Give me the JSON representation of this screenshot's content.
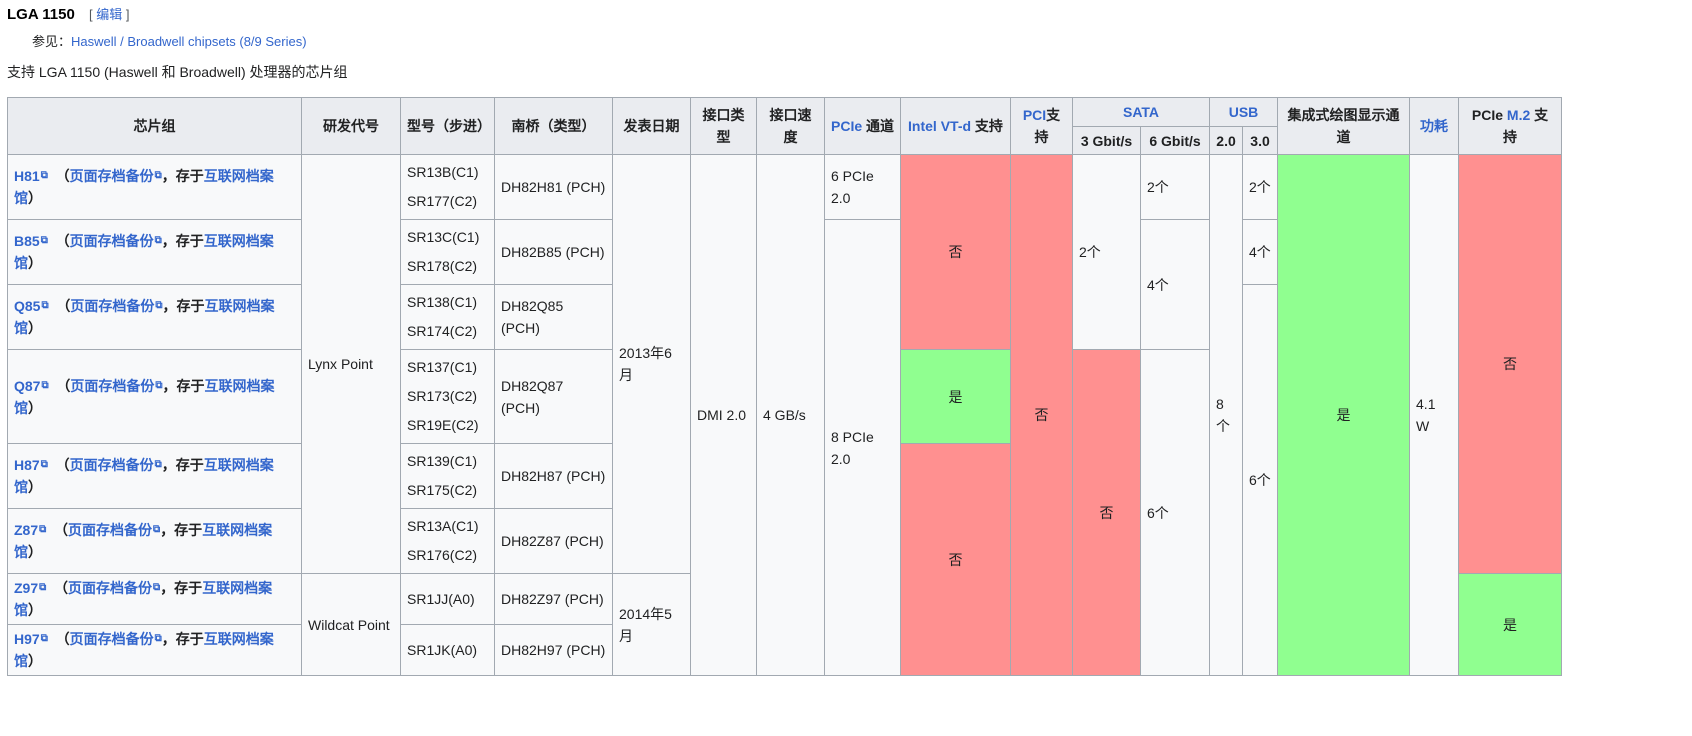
{
  "heading": {
    "title": "LGA 1150",
    "edit_open": "[ ",
    "edit_label": "编辑",
    "edit_close": " ]"
  },
  "see_also": {
    "prefix": "参见：",
    "link": "Haswell / Broadwell chipsets (8/9 Series)"
  },
  "intro": "支持 LGA 1150 (Haswell 和 Broadwell) 处理器的芯片组",
  "headers": {
    "chipset": "芯片组",
    "codename": "研发代号",
    "part": "型号（步进）",
    "southbridge": "南桥（类型）",
    "release": "发表日期",
    "interface": "接口类型",
    "speed": "接口速度",
    "pcie_link": "PCIe",
    "pcie_rest": " 通道",
    "vtd_link": "Intel VT-d",
    "vtd_rest": " 支持",
    "pci_link": "PCI",
    "pci_rest": "支持",
    "sata": "SATA",
    "sata3": "3 Gbit/s",
    "sata6": "6 Gbit/s",
    "usb": "USB",
    "usb2": "2.0",
    "usb3": "3.0",
    "igpu": "集成式绘图显示通道",
    "tdp": "功耗",
    "m2_pre": "PCIe ",
    "m2_link": "M.2",
    "m2_rest": " 支持"
  },
  "archive": {
    "open": "（",
    "backup": "页面存档备份",
    "sep": "，存于",
    "ia": "互联网档案馆",
    "close": "）"
  },
  "rows": [
    {
      "name": "H81",
      "part": [
        "SR13B(C1)",
        "SR177(C2)"
      ],
      "pch": "DH82H81 (PCH)"
    },
    {
      "name": "B85",
      "part": [
        "SR13C(C1)",
        "SR178(C2)"
      ],
      "pch": "DH82B85 (PCH)"
    },
    {
      "name": "Q85",
      "part": [
        "SR138(C1)",
        "SR174(C2)"
      ],
      "pch": "DH82Q85 (PCH)"
    },
    {
      "name": "Q87",
      "part": [
        "SR137(C1)",
        "SR173(C2)",
        "SR19E(C2)"
      ],
      "pch": "DH82Q87 (PCH)"
    },
    {
      "name": "H87",
      "part": [
        "SR139(C1)",
        "SR175(C2)"
      ],
      "pch": "DH82H87 (PCH)"
    },
    {
      "name": "Z87",
      "part": [
        "SR13A(C1)",
        "SR176(C2)"
      ],
      "pch": "DH82Z87 (PCH)"
    },
    {
      "name": "Z97",
      "part": [
        "SR1JJ(A0)"
      ],
      "pch": "DH82Z97 (PCH)"
    },
    {
      "name": "H97",
      "part": [
        "SR1JK(A0)"
      ],
      "pch": "DH82H97 (PCH)"
    }
  ],
  "cells": {
    "lynx": "Lynx Point",
    "wildcat": "Wildcat Point",
    "date2013": "2013年6月",
    "date2014": "2014年5月",
    "dmi": "DMI 2.0",
    "speed": "4 GB/s",
    "pcie6": "6 PCIe 2.0",
    "pcie8": "8 PCIe 2.0",
    "no": "否",
    "yes": "是",
    "two": "2个",
    "four": "4个",
    "six": "6个",
    "usb2_all": "8个",
    "tdp": "4.1 W"
  },
  "colors": {
    "no": "#ff9090",
    "yes": "#90ff90",
    "header": "#eaecf0",
    "link": "#3366cc"
  }
}
